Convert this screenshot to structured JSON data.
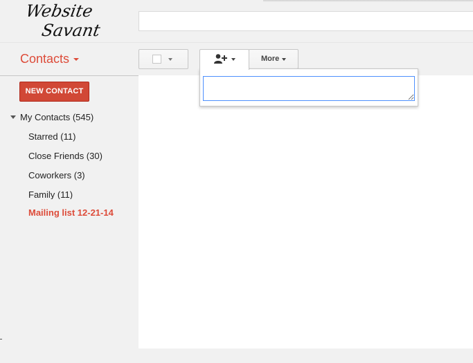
{
  "logo": {
    "text": "Website Savant"
  },
  "search": {
    "placeholder": ""
  },
  "header": {
    "app_title": "Contacts"
  },
  "toolbar": {
    "select_label": "",
    "add_icon": "person-add-icon",
    "more_label": "More"
  },
  "dropdown": {
    "value": ""
  },
  "sidebar": {
    "new_contact_label": "NEW CONTACT",
    "my_contacts": "My Contacts (545)",
    "items": [
      {
        "label": "Starred (11)"
      },
      {
        "label": "Close Friends (30)"
      },
      {
        "label": "Coworkers (3)"
      },
      {
        "label": "Family (11)"
      },
      {
        "label": "Mailing list 12-21-14"
      }
    ]
  },
  "colors": {
    "accent": "#dd4b39",
    "button_red": "#d14836",
    "focus_blue": "#4d90fe"
  }
}
